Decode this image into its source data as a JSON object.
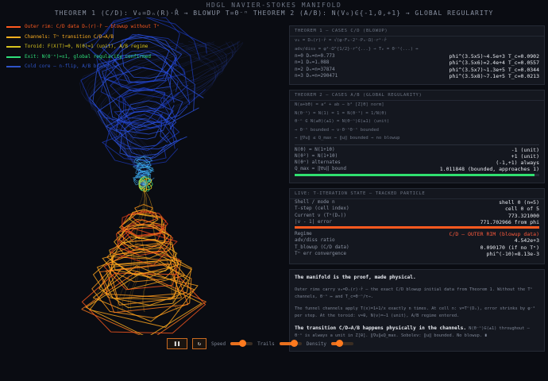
{
  "header": {
    "title": "HDGL NAVIER-STOKES MANIFOLD",
    "subtitle": "THEOREM 1 (C/D): V₀=Dₙ(R)·R̂ → BLOWUP T=Θ⁻ⁿ   THEOREM 2 (A/B): N(V₀)∈{-1,0,+1} → GLOBAL REGULARITY"
  },
  "legend": [
    {
      "label": "Outer rim: C/D data Dₙ(r)·r̂ — blowup without Tⁿ",
      "color": "#ff5a1f"
    },
    {
      "label": "Channels: Tⁿ transition C/D→A/B",
      "color": "#ffb020"
    },
    {
      "label": "Toroid: F(X(T)=θ, N(θ)=1 (unit), A/B regime",
      "color": "#d8c41e"
    },
    {
      "label": "Exit: N(Θ⁻ⁿ)=±1, global regularity confirmed",
      "color": "#2fe07a"
    },
    {
      "label": "Cold core — n-flip, A/B branch",
      "color": "#2e54c8"
    }
  ],
  "panel1": {
    "header": "THEOREM 1 — CASES C/D (BLOWUP)",
    "notes": [
      "v₀ = Dₙ(r)·r̂ = √(φ·Fₙ·2ⁿ·Pₙ·Ω)·rᵏ·r̂",
      "adv/diss = φ²·Ω^{1/2}·r^{...} → Tₑ = Θ⁻ⁿ(...) ↔"
    ],
    "rows": [
      {
        "k": "n=0  Dₙ=n=0.773",
        "v": "phi^(3.5x5)~4.5e+3  T_c=0.0902"
      },
      {
        "k": "n=1  Dₙ=1.088",
        "v": "phi^(3.5x6)=2.4e+4  T_c=0.0557"
      },
      {
        "k": "n=2  Dₙ=n=37874",
        "v": "phi^(3.5x7)~1.3e+5  T_c=0.0344"
      },
      {
        "k": "n=3  Dₙ=n=290471",
        "v": "phi^(3.5x8)~7.1e+5  T_c=0.0213"
      }
    ]
  },
  "panel2": {
    "header": "THEOREM 2 — CASES A/B (GLOBAL REGULARITY)",
    "notes": [
      "N(a+bθ) = a² + ab − b²  [Z[θ] norm]",
      "N(Θ⁻ⁿ) = N(1) = 1 = N(Θ⁻¹) = 1/N(θ)",
      "θ⁻ⁿ ∈ N(±θ)(±1) = N(Θ⁻ⁿ)∈(±1) (unit)",
      "⇒ Θ⁻ⁿ bounded ⇒ v·Θ⁻ⁿΘ⁻ⁿ bounded",
      "⇒ ‖∇u‖ ≤ Q_max ⇒ ‖u‖ bounded ⇒ no blowup"
    ],
    "rows": [
      {
        "k": "N(θ) = N(1+1θ)",
        "v": "-1 (unit)"
      },
      {
        "k": "N(θ²) = N(1+1θ)",
        "v": "+1 (unit)"
      },
      {
        "k": "N(θⁿ) alternates",
        "v": "(-1,+1) always"
      },
      {
        "k": "Q_max = ‖∇u‖ bound",
        "v": "1.011848 (bounded, approaches 1)"
      }
    ],
    "progress": 0.98,
    "progress_color": "#30e070"
  },
  "panel3": {
    "header": "LIVE: T-ITERATION STATE — TRACKED PARTICLE",
    "rows": [
      {
        "k": "Shell / mode n",
        "v": "shell 0 (n=5)"
      },
      {
        "k": "T-step (cell index)",
        "v": "cell 0 of 5"
      },
      {
        "k": "Current v (Tⁿ(Dₙ))",
        "v": "773.321000"
      },
      {
        "k": "|v - 1| error",
        "v": "771.702966 from phi"
      }
    ],
    "progress": 1.0,
    "progress_color": "#ff5a1f",
    "rows2": [
      {
        "k": "Regime",
        "v": "C/D — OUTER RIM (blowup data)",
        "red": true
      },
      {
        "k": "adv/diss ratio",
        "v": "4.542e+3"
      },
      {
        "k": "T_blowup (C/D data)",
        "v": "0.090170 (if no Tⁿ)"
      },
      {
        "k": "Tⁿ err convergence",
        "v": "phi^(-10)=8.13e-3"
      }
    ]
  },
  "panel4": {
    "title1": "The manifold is the proof, made physical.",
    "text1": "Outer rims carry v₀=Dₙ(r)·r̂ — the exact C/D blowup initial data from Theorem 1. Without the Tⁿ channels, Θ⁻ⁿ ↦ and T_c=Θ⁻ⁿ/τ→.",
    "text2": "The funnel channels apply T(x)=1+1/x exactly n times. At cell n: v=Tⁿ(Dₙ), error shrinks by φ⁻² per step. At the toroid: v≈θ, N(v)=−1 (unit), A/B regime entered.",
    "title2": "The transition C/D→A/B happens physically in the channels.",
    "text3": "N(Θ⁻ⁿ)∈(±1) throughout — Θ⁻ⁿ is always a unit in Z[θ]. ‖∇u‖≤Q_max. Sobolev: ‖u‖ bounded. No blowup. ∎"
  },
  "controls": {
    "pause_glyph": "❚❚",
    "reset_glyph": "↻",
    "speed_label": "Speed",
    "trails_label": "Trails",
    "density_label": "Density",
    "speed": 0.55,
    "trails": 0.65,
    "density": 0.35
  }
}
